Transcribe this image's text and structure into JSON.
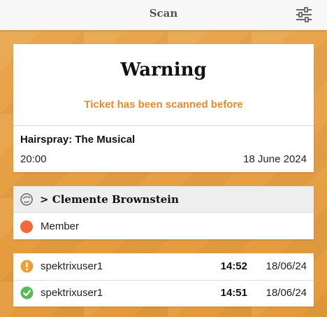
{
  "header": {
    "title": "Scan",
    "filter_icon": "sliders-icon"
  },
  "warning": {
    "title": "Warning",
    "message": "Ticket has been scanned before",
    "message_color": "#e38a33"
  },
  "event": {
    "name": "Hairspray: The Musical",
    "time": "20:00",
    "date": "18 June 2024"
  },
  "customer": {
    "icon": "customer-face-icon",
    "name": "> Clemente Brownstein",
    "membership": {
      "label": "Member",
      "color": "#f26a3a"
    }
  },
  "scan_log": [
    {
      "status_icon": "warning-icon",
      "status_color": "#e4a13c",
      "user": "spektrixuser1",
      "time": "14:52",
      "date": "18/06/24"
    },
    {
      "status_icon": "check-icon",
      "status_color": "#5cb85c",
      "user": "spektrixuser1",
      "time": "14:51",
      "date": "18/06/24"
    }
  ],
  "colors": {
    "background": "#e9a44a",
    "accent": "#e38a33"
  }
}
